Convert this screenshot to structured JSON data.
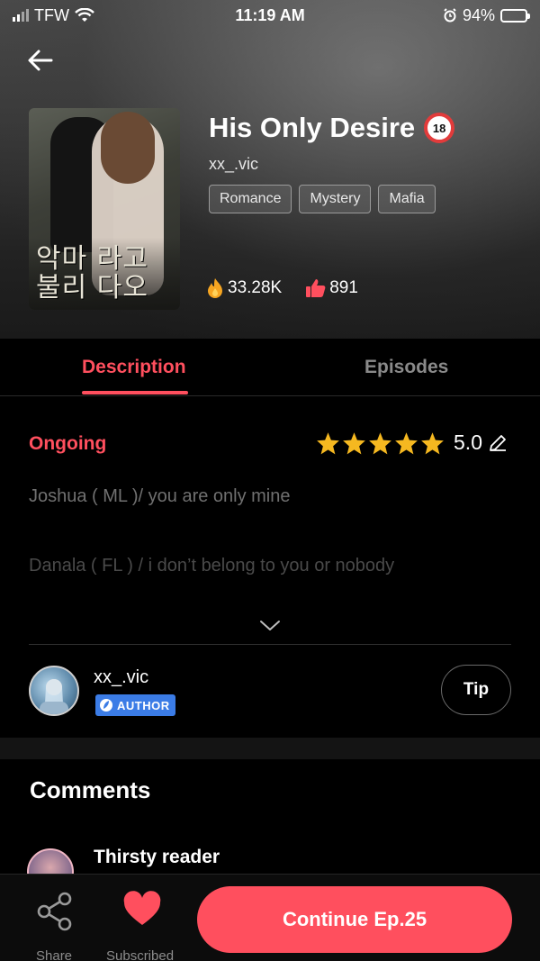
{
  "status_bar": {
    "carrier": "TFW",
    "time": "11:19 AM",
    "battery": "94%",
    "battery_level": 0.94,
    "icons": [
      "signal-icon",
      "wifi-icon",
      "alarm-icon",
      "battery-icon"
    ]
  },
  "header": {
    "back_icon": "arrow-left-icon",
    "title": "His Only Desire",
    "age_rating": "18",
    "author": "xx_.vic",
    "tags": [
      "Romance",
      "Mystery",
      "Mafia"
    ],
    "views": "33.28K",
    "likes": "891",
    "cover_text": "악마 라고 불리 다오"
  },
  "tabs": [
    {
      "label": "Description",
      "active": true
    },
    {
      "label": "Episodes",
      "active": false
    }
  ],
  "description": {
    "status": "Ongoing",
    "rating": "5.0",
    "stars": 5,
    "lines": [
      "Joshua ( ML )/ you are only mine",
      "Danala ( FL ) / i don’t belong to you or nobody"
    ]
  },
  "author_card": {
    "name": "xx_.vic",
    "badge": "AUTHOR",
    "tip_label": "Tip"
  },
  "comments": {
    "title": "Comments",
    "first_commenter": "Thirsty reader"
  },
  "bottom_bar": {
    "share_label": "Share",
    "subscribed_label": "Subscribed",
    "continue_label": "Continue Ep.25"
  },
  "colors": {
    "accent": "#ff4f5e",
    "badge_blue": "#3b7ce6",
    "star": "#f5b820"
  }
}
